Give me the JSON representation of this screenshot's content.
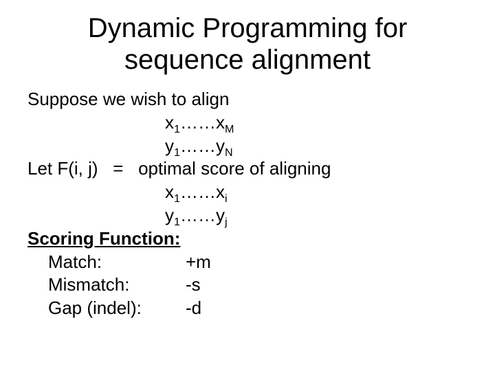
{
  "title": "Dynamic Programming for sequence alignment",
  "suppose": "Suppose we wish to align",
  "seq1_prefix": "x",
  "seq1_sub1": "1",
  "seq1_dots": "……",
  "seq1_prefix2": "x",
  "seq1_sub2": "M",
  "seq2_prefix": "y",
  "seq2_sub1": "1",
  "seq2_dots": "……",
  "seq2_prefix2": "y",
  "seq2_sub2": "N",
  "let_line": "Let F(i, j)   =   optimal score of aligning",
  "sub_seq1_prefix": "x",
  "sub_seq1_sub1": "1",
  "sub_seq1_dots": "……",
  "sub_seq1_prefix2": "x",
  "sub_seq1_sub2": "i",
  "sub_seq2_prefix": "y",
  "sub_seq2_sub1": "1",
  "sub_seq2_dots": "……",
  "sub_seq2_prefix2": "y",
  "sub_seq2_sub2": "j",
  "scoring_header": "Scoring Function:",
  "match_label": "Match:",
  "match_value": "+m",
  "mismatch_label": "Mismatch:",
  "mismatch_value": "-s",
  "gap_label": "Gap (indel):",
  "gap_value": "-d"
}
